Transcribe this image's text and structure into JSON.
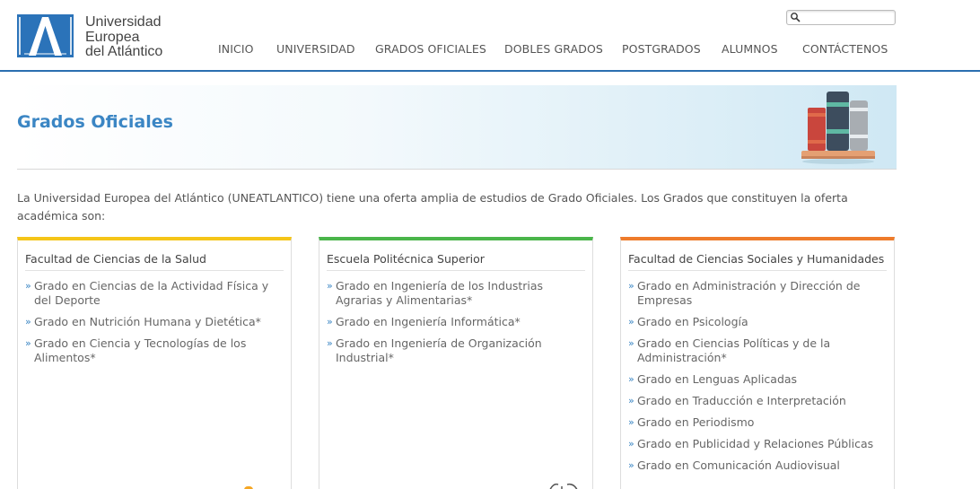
{
  "brand": {
    "name_line1": "Universidad",
    "name_line2": "Europea",
    "name_line3": "del Atlántico",
    "color": "#2b73b9"
  },
  "search": {
    "placeholder": "",
    "value": "",
    "icon": "search-icon"
  },
  "nav": [
    "INICIO",
    "UNIVERSIDAD",
    "GRADOS OFICIALES",
    "DOBLES GRADOS",
    "POSTGRADOS",
    "ALUMNOS",
    "CONTÁCTENOS"
  ],
  "banner": {
    "title": "Grados Oficiales",
    "icon": "books-icon"
  },
  "intro": "La Universidad Europea del Atlántico (UNEATLANTICO) tiene una oferta amplia de estudios de Grado Oficiales. Los Grados que constituyen la oferta académica son:",
  "columns": [
    {
      "title": "Facultad de Ciencias de la Salud",
      "accent": "#f5c518",
      "items": [
        "Grado en Ciencias de la Actividad Física y del Deporte",
        "Grado en Nutrición Humana y Dietética*",
        "Grado en Ciencia y Tecnologías de los Alimentos*"
      ]
    },
    {
      "title": "Escuela Politécnica Superior",
      "accent": "#4ab54a",
      "items": [
        "Grado en Ingeniería de los Industrias Agrarias y Alimentarias*",
        "Grado en Ingeniería Informática*",
        "Grado en Ingeniería de Organización Industrial*"
      ]
    },
    {
      "title": "Facultad de Ciencias Sociales y Humanidades",
      "accent": "#ee7b2b",
      "items": [
        "Grado en Administración y Dirección de Empresas",
        "Grado en Psicología",
        "Grado en Ciencias Políticas y de la Administración*",
        "Grado en Lenguas Aplicadas",
        "Grado en Traducción e Interpretación",
        "Grado en Periodismo",
        "Grado en Publicidad y Relaciones Públicas",
        "Grado en Comunicación Audiovisual"
      ]
    }
  ],
  "bullet": "»"
}
